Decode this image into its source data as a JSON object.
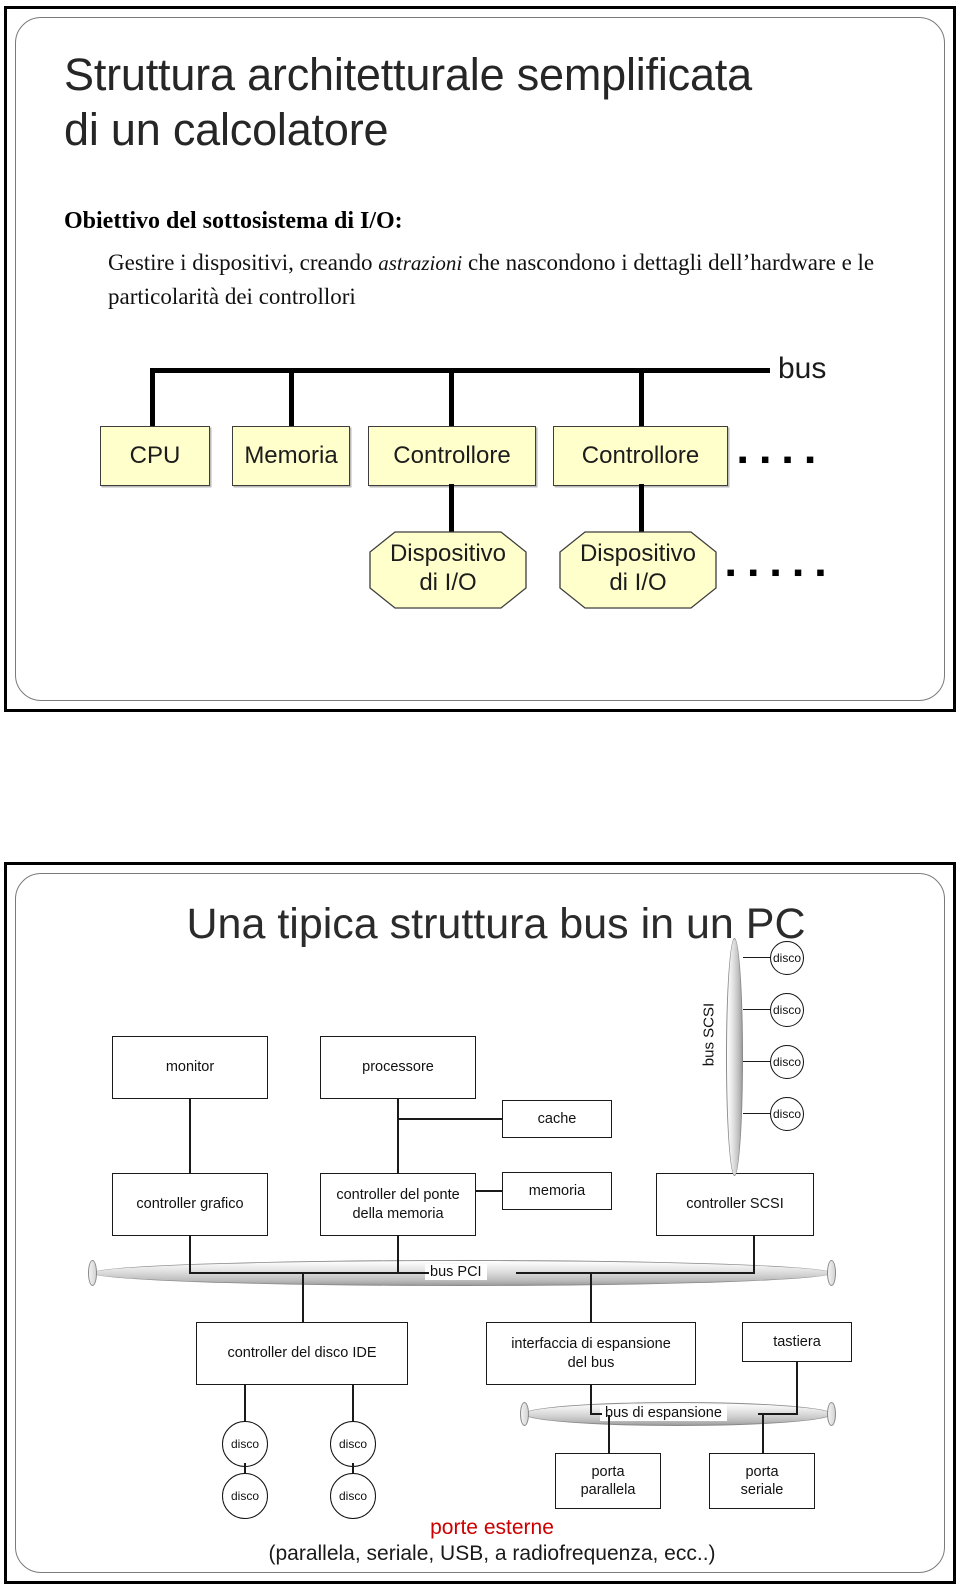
{
  "slide1": {
    "title": "Struttura architetturale semplificata\ndi un calcolatore",
    "heading": "Obiettivo del sottosistema di I/O:",
    "body_pre": "Gestire i dispositivi, creando ",
    "body_italic": "astrazioni",
    "body_post": " che nascondono i dettagli dell’hardware e le particolarità dei controllori",
    "diagram": {
      "bus_label": "bus",
      "nodes": [
        {
          "id": "cpu",
          "label": "CPU"
        },
        {
          "id": "memoria",
          "label": "Memoria"
        },
        {
          "id": "controllore1",
          "label": "Controllore"
        },
        {
          "id": "controllore2",
          "label": "Controllore"
        }
      ],
      "devices": [
        {
          "id": "dispositivo1",
          "label": "Dispositivo\ndi I/O"
        },
        {
          "id": "dispositivo2",
          "label": "Dispositivo\ndi I/O"
        }
      ],
      "ellipsis_controllers": "▪ ▪ ▪ ▪",
      "ellipsis_devices": "▪ ▪ ▪ ▪ ▪",
      "node_fill": "#FFFFCC",
      "line_color": "#000000"
    }
  },
  "slide2": {
    "title": "Una tipica struttura bus in un PC",
    "diagram": {
      "boxes": [
        {
          "id": "monitor",
          "label": "monitor"
        },
        {
          "id": "controller-grafico",
          "label": "controller grafico"
        },
        {
          "id": "processore",
          "label": "processore"
        },
        {
          "id": "controller-ponte",
          "label": "controller del ponte\ndella memoria"
        },
        {
          "id": "cache",
          "label": "cache"
        },
        {
          "id": "memoria",
          "label": "memoria"
        },
        {
          "id": "controller-scsi",
          "label": "controller SCSI"
        },
        {
          "id": "controller-ide",
          "label": "controller del disco IDE"
        },
        {
          "id": "interfaccia-espansione",
          "label": "interfaccia di espansione\ndel bus"
        },
        {
          "id": "tastiera",
          "label": "tastiera"
        },
        {
          "id": "porta-parallela",
          "label": "porta\nparallela"
        },
        {
          "id": "porta-seriale",
          "label": "porta\nseriale"
        }
      ],
      "buses": [
        {
          "id": "bus-scsi",
          "label": "bus SCSI",
          "orientation": "vertical"
        },
        {
          "id": "bus-pci",
          "label": "bus PCI",
          "orientation": "horizontal"
        },
        {
          "id": "bus-di-espansione",
          "label": "bus di espansione",
          "orientation": "horizontal"
        }
      ],
      "scsi_disks": [
        {
          "label": "disco"
        },
        {
          "label": "disco"
        },
        {
          "label": "disco"
        },
        {
          "label": "disco"
        }
      ],
      "ide_disks": [
        {
          "label": "disco"
        },
        {
          "label": "disco"
        },
        {
          "label": "disco"
        },
        {
          "label": "disco"
        }
      ],
      "caption_red": "porte esterne",
      "caption_detail": "(parallela, seriale, USB, a radiofrequenza, ecc..)",
      "caption_red_color": "#CC0000"
    }
  }
}
